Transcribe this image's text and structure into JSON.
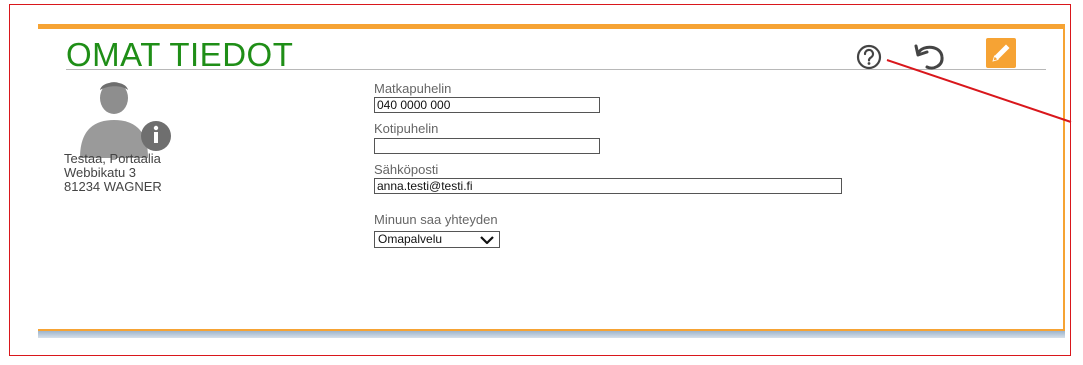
{
  "panel": {
    "title": "OMAT TIEDOT",
    "accent_color": "#f6a334",
    "title_color": "#1f8e17",
    "icons": [
      "help-icon",
      "undo-icon",
      "edit-icon"
    ]
  },
  "profile": {
    "name": "Testaa, Portaalia",
    "street": "Webbikatu 3",
    "city": "81234 WAGNER",
    "avatar_icon": "user-avatar-icon"
  },
  "form": {
    "mobile_label": "Matkapuhelin",
    "mobile_value": "040 0000 000",
    "home_label": "Kotipuhelin",
    "home_value": "",
    "email_label": "Sähköposti",
    "email_value": "anna.testi@testi.fi",
    "contact_label": "Minuun saa yhteyden",
    "contact_selected": "Omapalvelu"
  },
  "annotation": {
    "color": "#d9171c"
  }
}
